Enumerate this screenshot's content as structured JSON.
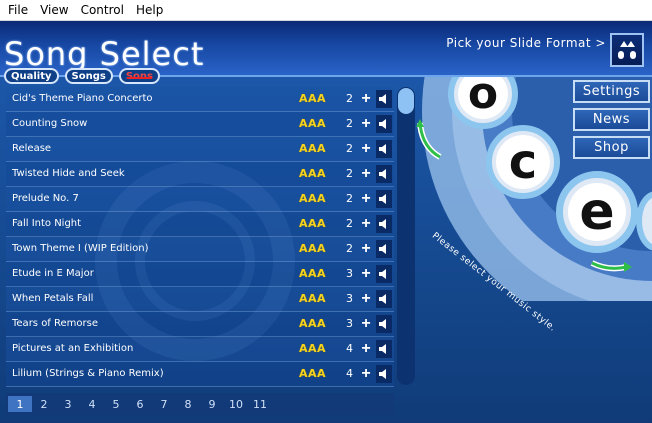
{
  "menu": [
    "File",
    "View",
    "Control",
    "Help"
  ],
  "header": {
    "title": "Song Select",
    "pick_format": "Pick your Slide Format >"
  },
  "sort_tabs": [
    {
      "label": "Quality",
      "disabled": false
    },
    {
      "label": "Songs",
      "disabled": false
    },
    {
      "label": "Sons",
      "disabled": true
    }
  ],
  "songs": [
    {
      "title": "Cid's Theme Piano Concerto",
      "grade": "AAA",
      "difficulty": "2"
    },
    {
      "title": "Counting Snow",
      "grade": "AAA",
      "difficulty": "2"
    },
    {
      "title": "Release",
      "grade": "AAA",
      "difficulty": "2"
    },
    {
      "title": "Twisted Hide and Seek",
      "grade": "AAA",
      "difficulty": "2"
    },
    {
      "title": "Prelude No. 7",
      "grade": "AAA",
      "difficulty": "2"
    },
    {
      "title": "Fall Into Night",
      "grade": "AAA",
      "difficulty": "2"
    },
    {
      "title": "Town Theme I (WIP Edition)",
      "grade": "AAA",
      "difficulty": "2"
    },
    {
      "title": "Etude in E Major",
      "grade": "AAA",
      "difficulty": "3"
    },
    {
      "title": "When Petals Fall",
      "grade": "AAA",
      "difficulty": "3"
    },
    {
      "title": "Tears of Remorse",
      "grade": "AAA",
      "difficulty": "3"
    },
    {
      "title": "Pictures at an Exhibition",
      "grade": "AAA",
      "difficulty": "4"
    },
    {
      "title": "Lilium (Strings & Piano Remix)",
      "grade": "AAA",
      "difficulty": "4"
    }
  ],
  "pages": [
    "1",
    "2",
    "3",
    "4",
    "5",
    "6",
    "7",
    "8",
    "9",
    "10",
    "11"
  ],
  "active_page": "1",
  "side_buttons": [
    "Settings",
    "News",
    "Shop"
  ],
  "style_hint": "Please select your music style.",
  "style_wheel": [
    "o",
    "c",
    "e"
  ],
  "colors": {
    "grade": "#f4d31e",
    "header_dark": "#0b2a78",
    "background": "#1e5bb0",
    "arrow_green": "#2fbf48"
  }
}
